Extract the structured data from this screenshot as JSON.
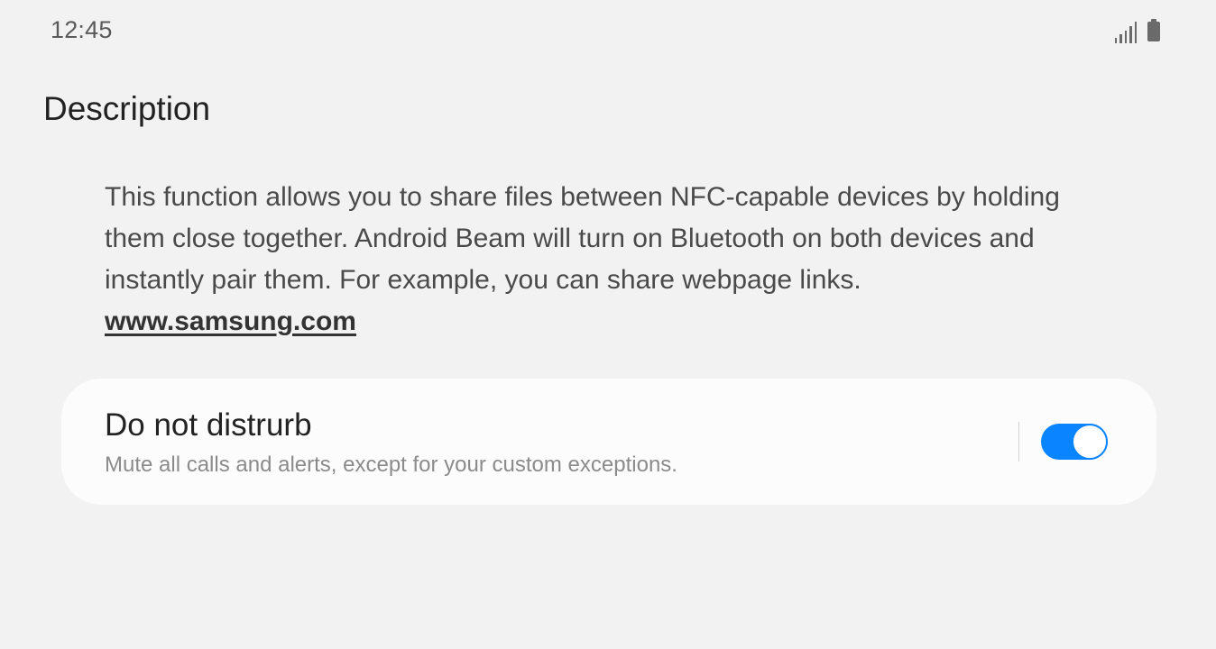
{
  "status_bar": {
    "time": "12:45",
    "icons": [
      "signal-icon",
      "battery-icon"
    ]
  },
  "header": {
    "title": "Description"
  },
  "description": {
    "text": "This function allows you to share files between NFC-capable devices by holding them close together. Android Beam will  turn on Bluetooth on both devices and instantly pair them. For example, you can share webpage links.",
    "link": "www.samsung.com"
  },
  "dnd_card": {
    "title": "Do not distrurb",
    "subtitle": "Mute all calls and alerts, except for your custom exceptions.",
    "toggle_state": "on"
  },
  "colors": {
    "background": "#f2f2f2",
    "card": "#fcfcfc",
    "accent": "#0a84ff"
  }
}
